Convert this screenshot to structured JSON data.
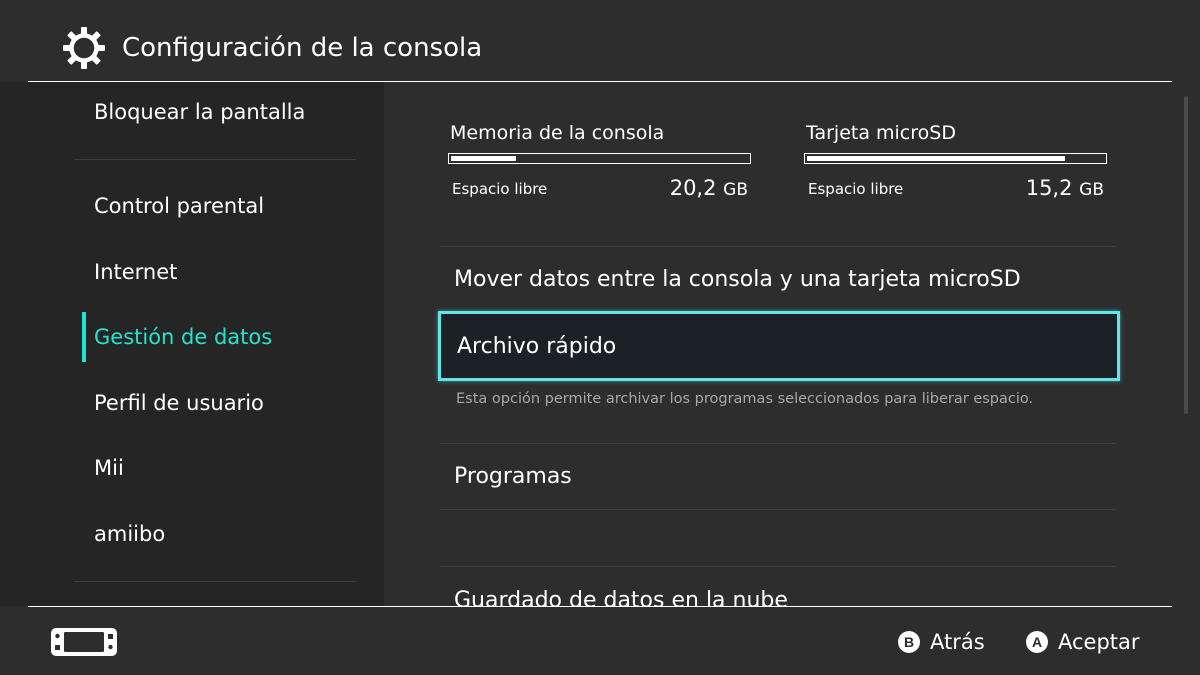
{
  "header": {
    "title": "Configuración de la consola",
    "icon": "gear-icon"
  },
  "sidebar": {
    "items": [
      {
        "label": "Bloquear la pantalla"
      },
      {
        "label": "Control parental"
      },
      {
        "label": "Internet"
      },
      {
        "label": "Gestión de datos",
        "active": true
      },
      {
        "label": "Perfil de usuario"
      },
      {
        "label": "Mii"
      },
      {
        "label": "amiibo"
      }
    ]
  },
  "storage": {
    "console": {
      "title": "Memoria de la consola",
      "free_label": "Espacio libre",
      "free_value": "20,2",
      "unit": "GB",
      "used_fraction": 0.22
    },
    "microsd": {
      "title": "Tarjeta microSD",
      "free_label": "Espacio libre",
      "free_value": "15,2",
      "unit": "GB",
      "used_fraction": 0.87
    }
  },
  "main": {
    "items": [
      {
        "label": "Mover datos entre la consola y una tarjeta microSD"
      },
      {
        "label": "Archivo rápido",
        "selected": true,
        "description": "Esta opción permite archivar los programas seleccionados para liberar espacio."
      },
      {
        "label": "Programas"
      },
      {
        "label": "Guardado de datos en la nube"
      }
    ]
  },
  "footer": {
    "back": {
      "button": "B",
      "label": "Atrás"
    },
    "accept": {
      "button": "A",
      "label": "Aceptar"
    }
  },
  "colors": {
    "background": "#2d2d2d",
    "sidebar": "#252525",
    "accent": "#1fe5cf",
    "selection": "#5ee6ea"
  }
}
